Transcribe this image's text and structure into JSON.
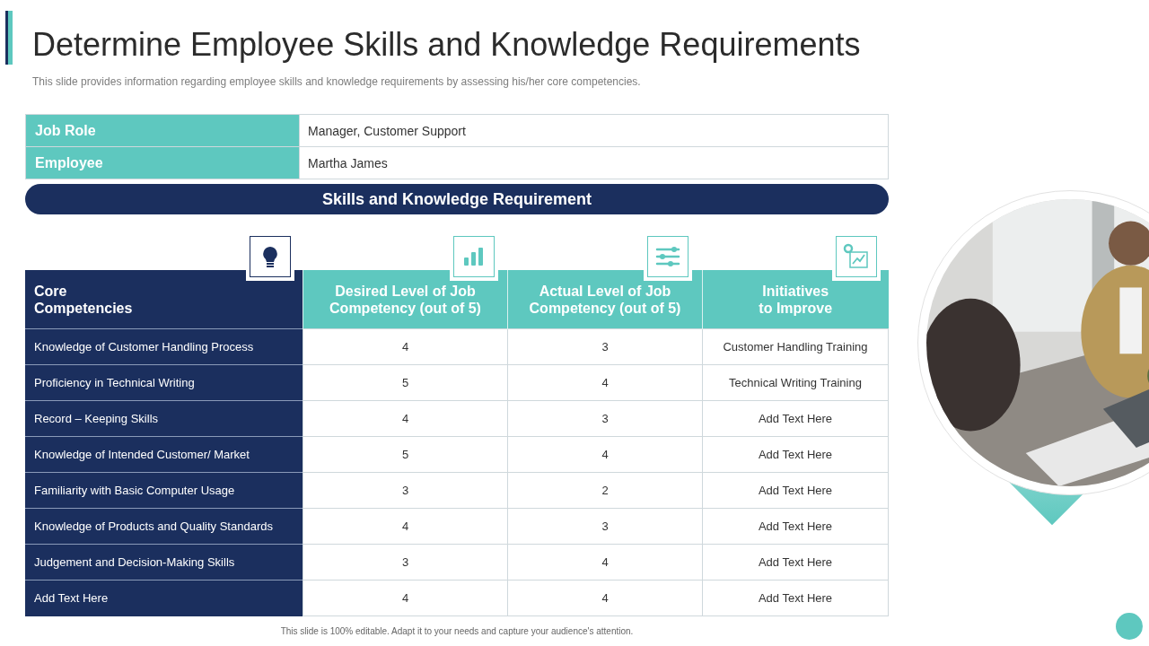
{
  "title": "Determine Employee Skills and Knowledge Requirements",
  "subtitle": "This slide provides  information  regarding  employee  skills and knowledge  requirements  by assessing his/her core competencies.",
  "info": [
    {
      "label": "Job Role",
      "value": "Manager,  Customer Support"
    },
    {
      "label": "Employee",
      "value": "Martha James"
    }
  ],
  "banner": "Skills and Knowledge Requirement",
  "table": {
    "columns": [
      "Core\nCompetencies",
      "Desired Level of Job\nCompetency (out of 5)",
      "Actual Level of Job\nCompetency (out of 5)",
      "Initiatives\nto Improve"
    ],
    "rows": [
      [
        "Knowledge  of Customer Handling   Process",
        "4",
        "3",
        "Customer Handling Training"
      ],
      [
        "Proficiency in Technical Writing",
        "5",
        "4",
        "Technical Writing Training"
      ],
      [
        "Record – Keeping Skills",
        "4",
        "3",
        "Add Text Here"
      ],
      [
        "Knowledge  of Intended Customer/ Market",
        "5",
        "4",
        "Add Text Here"
      ],
      [
        "Familiarity with Basic Computer Usage",
        "3",
        "2",
        "Add Text Here"
      ],
      [
        "Knowledge  of Products and Quality Standards",
        "4",
        "3",
        "Add Text Here"
      ],
      [
        "Judgement  and Decision-Making Skills",
        "3",
        "4",
        "Add Text Here"
      ],
      [
        "Add Text Here",
        "4",
        "4",
        "Add Text Here"
      ]
    ]
  },
  "footer": "This slide is 100% editable.  Adapt it to your needs and capture your audience's attention."
}
